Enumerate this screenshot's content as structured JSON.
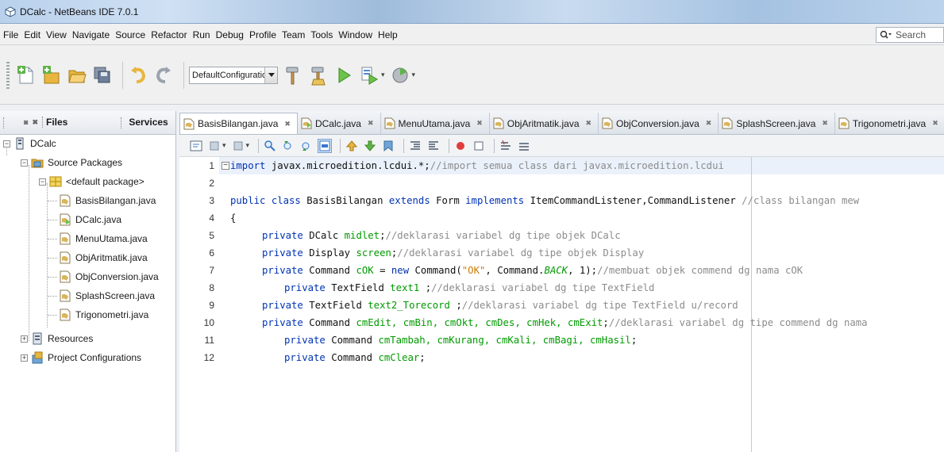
{
  "window": {
    "title": "DCalc - NetBeans IDE 7.0.1"
  },
  "menu": {
    "items": [
      "File",
      "Edit",
      "View",
      "Navigate",
      "Source",
      "Refactor",
      "Run",
      "Debug",
      "Profile",
      "Team",
      "Tools",
      "Window",
      "Help"
    ],
    "search_placeholder": "Search"
  },
  "toolbar": {
    "configuration": "DefaultConfiguration"
  },
  "project_panel": {
    "tab_files": "Files",
    "tab_services": "Services",
    "project_name": "DCalc",
    "source_packages": "Source Packages",
    "default_package": "<default package>",
    "files": [
      "BasisBilangan.java",
      "DCalc.java",
      "MenuUtama.java",
      "ObjAritmatik.java",
      "ObjConversion.java",
      "SplashScreen.java",
      "Trigonometri.java"
    ],
    "resources": "Resources",
    "project_configurations": "Project Configurations"
  },
  "editor": {
    "tabs": [
      "BasisBilangan.java",
      "DCalc.java",
      "MenuUtama.java",
      "ObjAritmatik.java",
      "ObjConversion.java",
      "SplashScreen.java",
      "Trigonometri.java"
    ],
    "line_numbers": [
      "1",
      "2",
      "3",
      "4",
      "5",
      "6",
      "7",
      "8",
      "9",
      "10",
      "11",
      "12"
    ],
    "code": {
      "l1_kw": "import",
      "l1_code": " javax.microedition.lcdui.*;",
      "l1_cm": "//import semua class dari javax.microedition.lcdui",
      "l3_kw1": "public class",
      "l3_name": " BasisBilangan ",
      "l3_kw2": "extends",
      "l3_mid": " Form ",
      "l3_kw3": "implements",
      "l3_ifaces": " ItemCommandListener,CommandListener ",
      "l3_cm": "//class bilangan mew",
      "l4": "{",
      "l5_kw": "private",
      "l5_type": " DCalc ",
      "l5_fd": "midlet",
      "l5_end": ";",
      "l5_cm": "//deklarasi variabel dg tipe objek DCalc",
      "l6_kw": "private",
      "l6_type": " Display ",
      "l6_fd": "screen",
      "l6_end": ";",
      "l6_cm": "//deklarasi variabel dg tipe objek Display",
      "l7_kw": "private",
      "l7_type": " Command ",
      "l7_fd": "cOK",
      "l7_eq": " = ",
      "l7_new": "new",
      "l7_call": " Command(",
      "l7_str": "\"OK\"",
      "l7_mid": ", Command.",
      "l7_it": "BACK",
      "l7_end": ", 1);",
      "l7_cm": "//membuat objek commend dg nama cOK",
      "l8_kw": "private",
      "l8_type": " TextField ",
      "l8_fd": "text1",
      "l8_end": " ;",
      "l8_cm": "//deklarasi variabel dg tipe TextField",
      "l9_kw": "private",
      "l9_type": " TextField ",
      "l9_fd": "text2_Torecord",
      "l9_end": " ;",
      "l9_cm": "//deklarasi variabel dg tipe TextField u/record",
      "l10_kw": "private",
      "l10_type": " Command ",
      "l10_fd": "cmEdit, cmBin, cmOkt, cmDes, cmHek, cmExit",
      "l10_end": ";",
      "l10_cm": "//deklarasi variabel dg tipe commend dg nama",
      "l11_kw": "private",
      "l11_type": " Command ",
      "l11_fd": "cmTambah, cmKurang, cmKali, cmBagi, cmHasil",
      "l11_end": ";",
      "l12_kw": "private",
      "l12_type": " Command ",
      "l12_fd": "cmClear",
      "l12_end": ";"
    }
  }
}
